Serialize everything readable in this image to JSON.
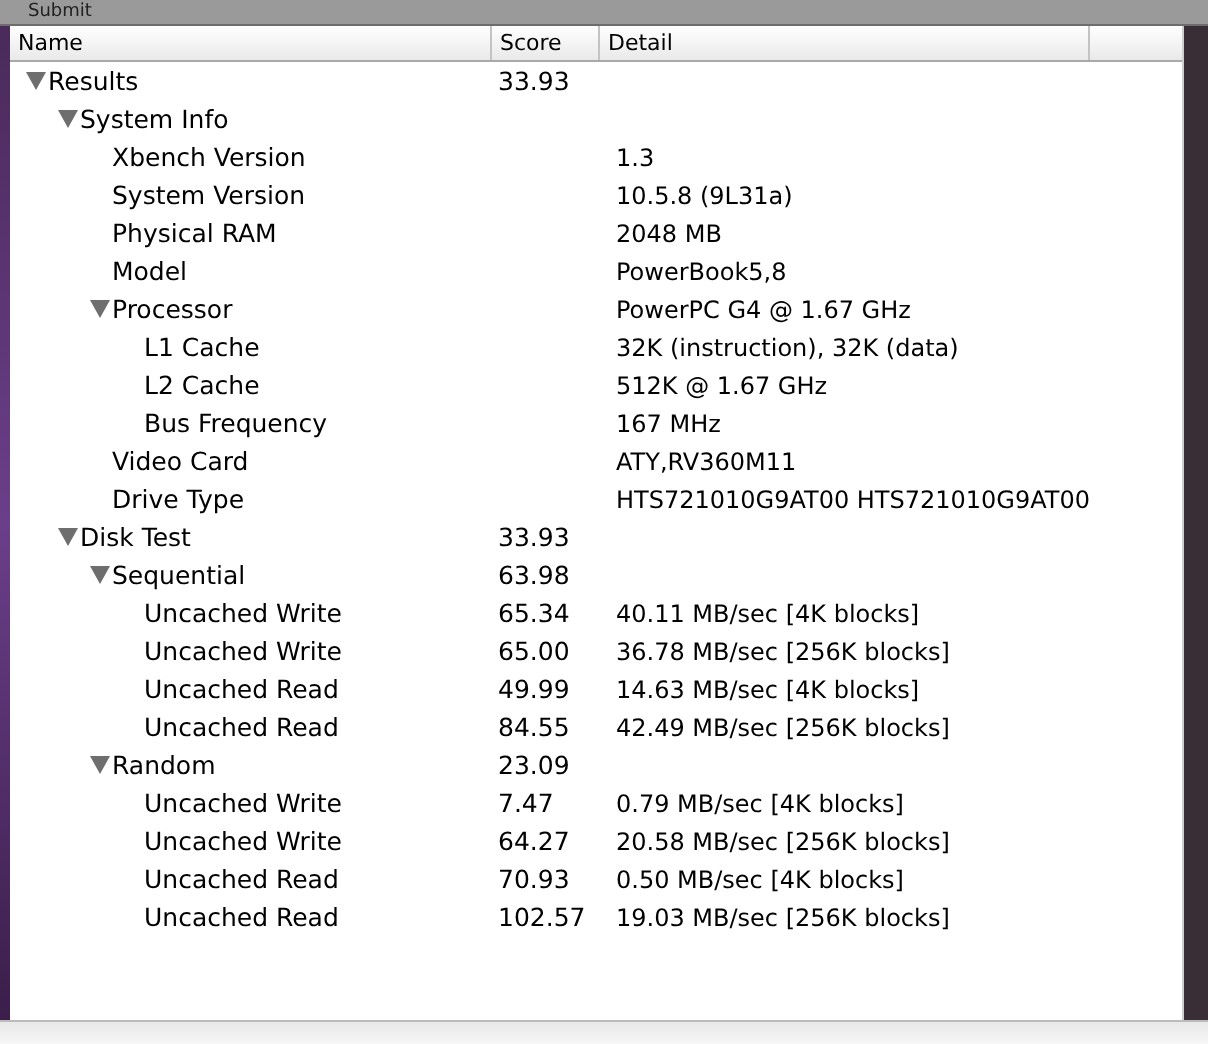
{
  "toolbar": {
    "button": "Submit"
  },
  "table": {
    "columns": [
      "Name",
      "Score",
      "Detail"
    ],
    "rows": [
      {
        "name": "Results",
        "score": "33.93",
        "expanded": true,
        "children": [
          {
            "name": "System Info",
            "expanded": true,
            "children": [
              {
                "name": "Xbench Version",
                "detail": "1.3"
              },
              {
                "name": "System Version",
                "detail": "10.5.8 (9L31a)"
              },
              {
                "name": "Physical RAM",
                "detail": "2048 MB"
              },
              {
                "name": "Model",
                "detail": "PowerBook5,8"
              },
              {
                "name": "Processor",
                "detail": "PowerPC G4 @ 1.67 GHz",
                "expanded": true,
                "children": [
                  {
                    "name": "L1 Cache",
                    "detail": "32K (instruction), 32K (data)"
                  },
                  {
                    "name": "L2 Cache",
                    "detail": "512K @ 1.67 GHz"
                  },
                  {
                    "name": "Bus Frequency",
                    "detail": "167 MHz"
                  }
                ]
              },
              {
                "name": "Video Card",
                "detail": "ATY,RV360M11"
              },
              {
                "name": "Drive Type",
                "detail": "HTS721010G9AT00 HTS721010G9AT00"
              }
            ]
          },
          {
            "name": "Disk Test",
            "score": "33.93",
            "expanded": true,
            "children": [
              {
                "name": "Sequential",
                "score": "63.98",
                "expanded": true,
                "children": [
                  {
                    "name": "Uncached Write",
                    "score": "65.34",
                    "detail": "40.11 MB/sec [4K blocks]"
                  },
                  {
                    "name": "Uncached Write",
                    "score": "65.00",
                    "detail": "36.78 MB/sec [256K blocks]"
                  },
                  {
                    "name": "Uncached Read",
                    "score": "49.99",
                    "detail": "14.63 MB/sec [4K blocks]"
                  },
                  {
                    "name": "Uncached Read",
                    "score": "84.55",
                    "detail": "42.49 MB/sec [256K blocks]"
                  }
                ]
              },
              {
                "name": "Random",
                "score": "23.09",
                "expanded": true,
                "children": [
                  {
                    "name": "Uncached Write",
                    "score": "7.47",
                    "detail": "0.79 MB/sec [4K blocks]"
                  },
                  {
                    "name": "Uncached Write",
                    "score": "64.27",
                    "detail": "20.58 MB/sec [256K blocks]"
                  },
                  {
                    "name": "Uncached Read",
                    "score": "70.93",
                    "detail": "0.50 MB/sec [4K blocks]"
                  },
                  {
                    "name": "Uncached Read",
                    "score": "102.57",
                    "detail": "19.03 MB/sec [256K blocks]"
                  }
                ]
              }
            ]
          }
        ]
      }
    ]
  }
}
